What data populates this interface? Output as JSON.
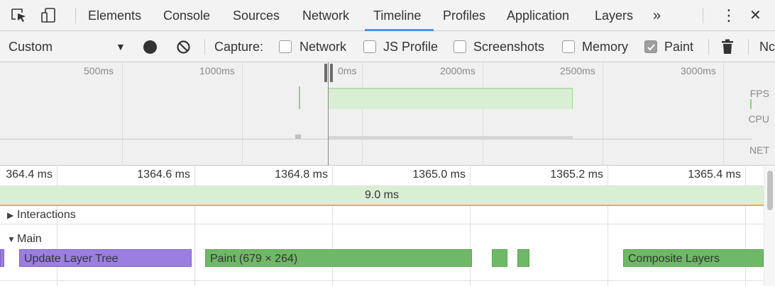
{
  "tabs": [
    {
      "label": "Elements"
    },
    {
      "label": "Console"
    },
    {
      "label": "Sources"
    },
    {
      "label": "Network"
    },
    {
      "label": "Timeline",
      "active": true
    },
    {
      "label": "Profiles"
    },
    {
      "label": "Application"
    },
    {
      "label": "Layers"
    }
  ],
  "tabbar": {
    "more_glyph": "»",
    "menu_glyph": "⋮",
    "close_glyph": "✕"
  },
  "toolbar": {
    "preset": "Custom",
    "dropdown_glyph": "▼",
    "capture_label": "Capture:",
    "options": [
      {
        "label": "Network",
        "checked": false
      },
      {
        "label": "JS Profile",
        "checked": false
      },
      {
        "label": "Screenshots",
        "checked": false
      },
      {
        "label": "Memory",
        "checked": false
      },
      {
        "label": "Paint",
        "checked": true
      }
    ],
    "truncated_label": "Nc"
  },
  "overview": {
    "ticks": [
      "500ms",
      "1000ms",
      "0ms",
      "2000ms",
      "2500ms",
      "3000ms"
    ],
    "lanes": [
      "FPS",
      "CPU",
      "NET"
    ]
  },
  "ruler": {
    "ticks": [
      "364.4 ms",
      "1364.6 ms",
      "1364.8 ms",
      "1365.0 ms",
      "1365.2 ms",
      "1365.4 ms"
    ]
  },
  "frames": {
    "duration": "9.0 ms"
  },
  "tracks": {
    "interactions": "Interactions",
    "main": "Main",
    "events": [
      {
        "label": "Update Layer Tree",
        "kind": "purple"
      },
      {
        "label": "Paint (679 × 264)",
        "kind": "green"
      },
      {
        "label": "",
        "kind": "green"
      },
      {
        "label": "",
        "kind": "green"
      },
      {
        "label": "Composite Layers",
        "kind": "green"
      }
    ]
  },
  "colors": {
    "accent": "#4d8ef7",
    "paint": "#6fb867",
    "layout": "#9a7fe0",
    "frame": "#d9efd4",
    "marker": "#f0a94a"
  }
}
